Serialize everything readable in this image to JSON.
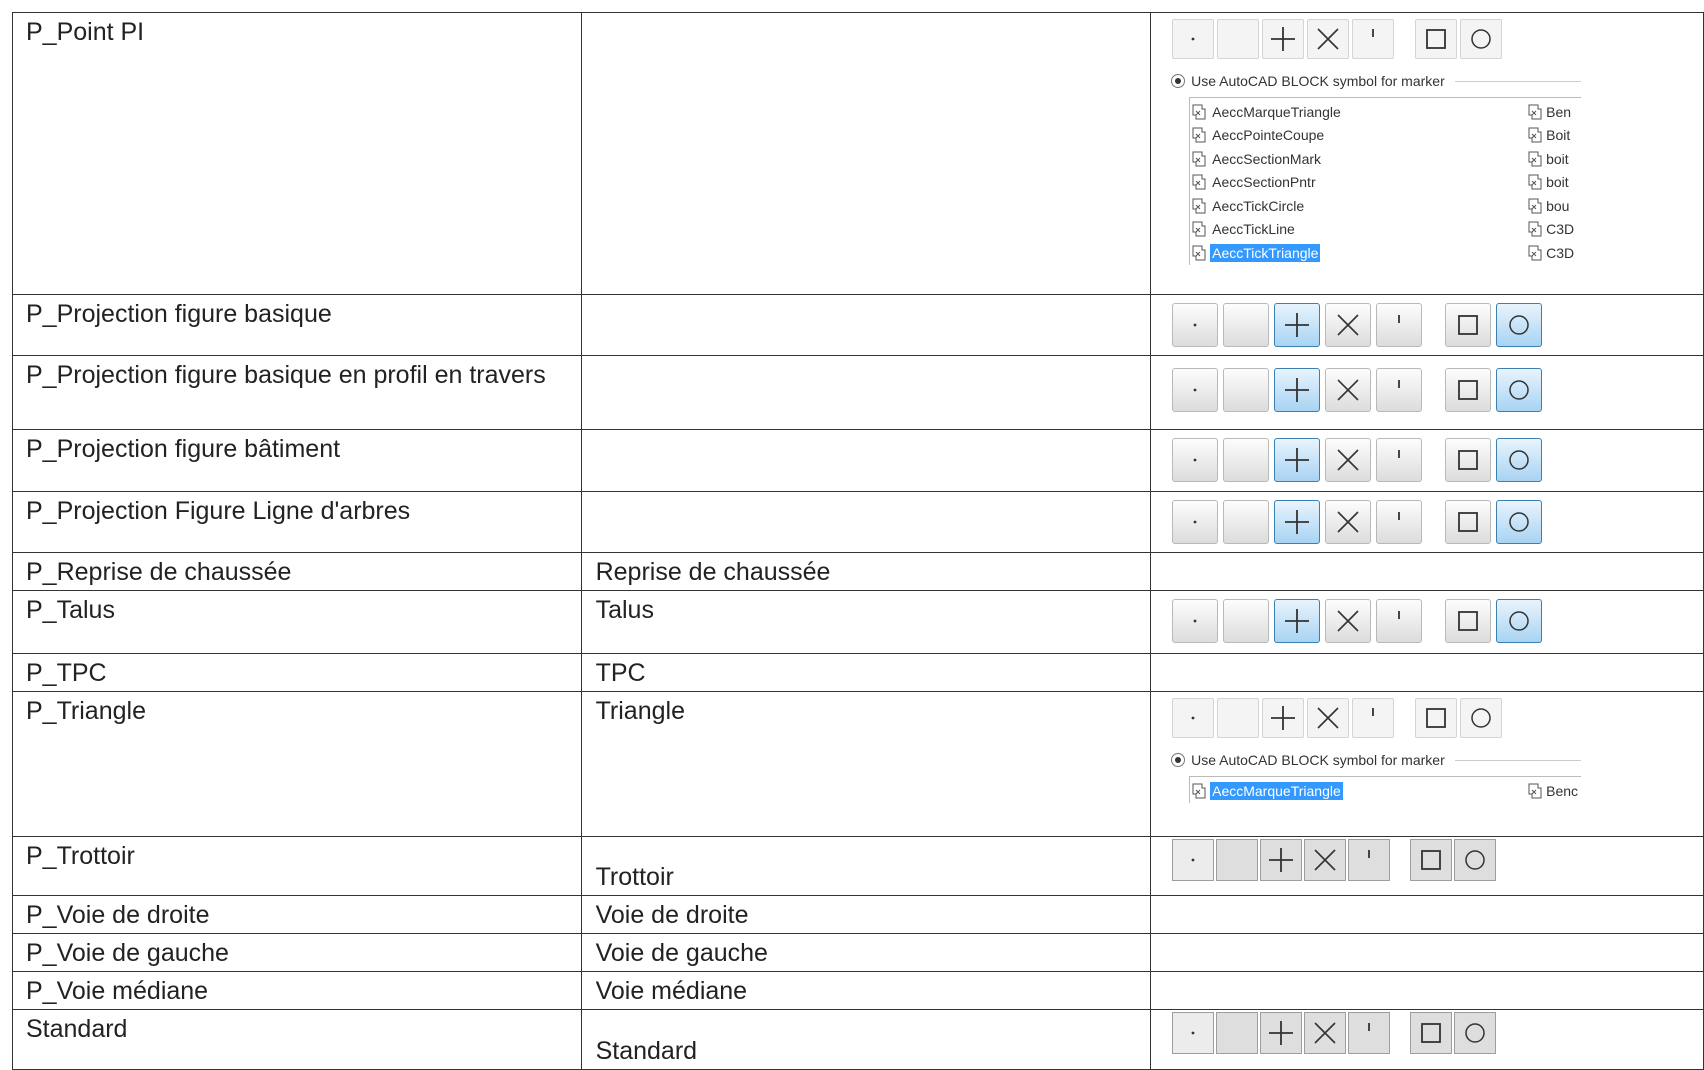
{
  "radio_label": "Use AutoCAD BLOCK symbol for marker",
  "block_list_1": {
    "left": [
      "AeccMarqueTriangle",
      "AeccPointeCoupe",
      "AeccSectionMark",
      "AeccSectionPntr",
      "AeccTickCircle",
      "AeccTickLine",
      "AeccTickTriangle"
    ],
    "right": [
      "Ben",
      "Boit",
      "boit",
      "boit",
      "bou",
      "C3D",
      "C3D"
    ],
    "selected_index": 6
  },
  "block_list_2": {
    "left": [
      "AeccMarqueTriangle"
    ],
    "right": [
      "Benc"
    ],
    "selected_index": 0
  },
  "rows": [
    {
      "col1": "P_Point PI",
      "col2": ""
    },
    {
      "col1": "P_Projection figure basique",
      "col2": ""
    },
    {
      "col1": "P_Projection figure basique en profil en travers",
      "col2": ""
    },
    {
      "col1": "P_Projection figure bâtiment",
      "col2": ""
    },
    {
      "col1": "P_Projection Figure Ligne d'arbres",
      "col2": ""
    },
    {
      "col1": "P_Reprise de chaussée",
      "col2": "Reprise de chaussée"
    },
    {
      "col1": "P_Talus",
      "col2": "Talus"
    },
    {
      "col1": "P_TPC",
      "col2": "TPC"
    },
    {
      "col1": "P_Triangle",
      "col2": "Triangle"
    },
    {
      "col1": "P_Trottoir",
      "col2": "Trottoir"
    },
    {
      "col1": "P_Voie de droite",
      "col2": "Voie de droite"
    },
    {
      "col1": "P_Voie de gauche",
      "col2": "Voie de gauche"
    },
    {
      "col1": "P_Voie médiane",
      "col2": "Voie médiane"
    },
    {
      "col1": "Standard",
      "col2": "Standard"
    }
  ],
  "marker_icons": [
    "dot-icon",
    "none-icon",
    "plus-icon",
    "x-icon",
    "tick-icon",
    "square-icon",
    "circle-icon"
  ],
  "colors": {
    "selected_button": "#a8d3f3",
    "selected_list_item": "#3399ff"
  }
}
